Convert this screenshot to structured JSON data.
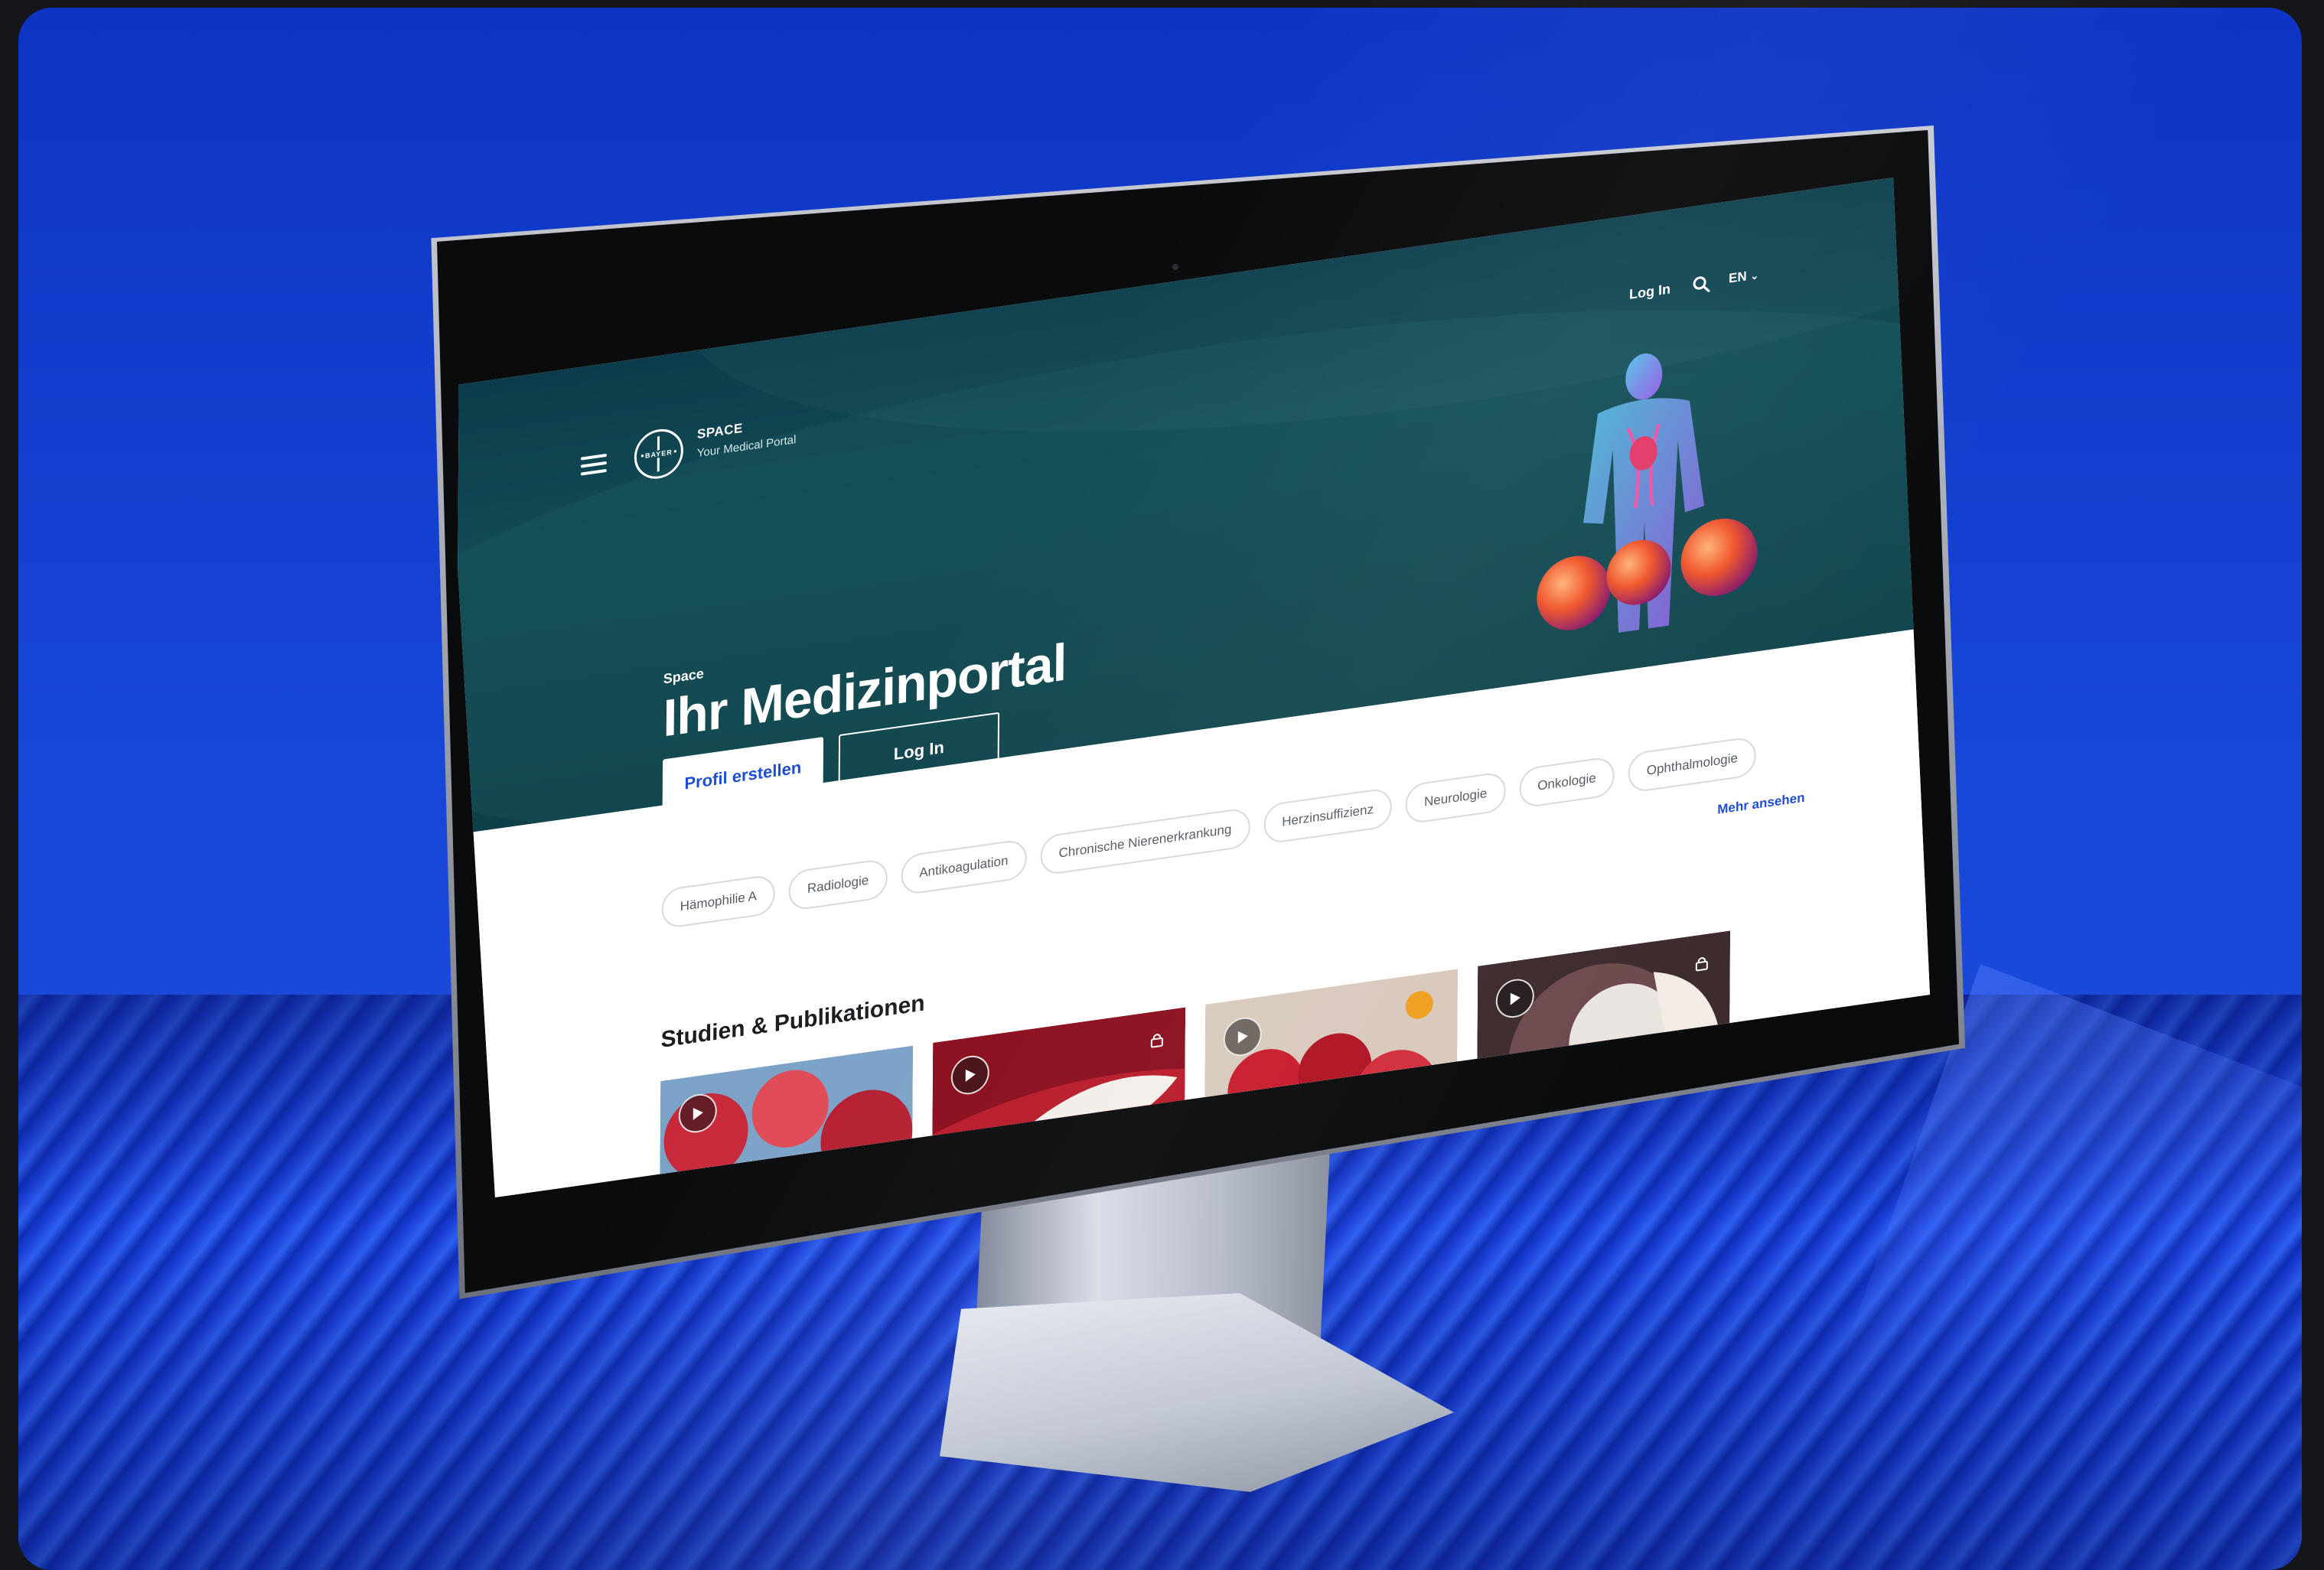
{
  "header": {
    "brand_name": "SPACE",
    "brand_tagline": "Your Medical Portal",
    "logo_text": "BAYER",
    "login_label": "Log In",
    "language_label": "EN"
  },
  "hero": {
    "eyebrow": "Space",
    "title": "Ihr Medizinportal",
    "primary_button": "Profil erstellen",
    "secondary_button": "Log In"
  },
  "topics": {
    "chips": [
      "Hämophilie A",
      "Radiologie",
      "Antikoagulation",
      "Chronische Nierenerkrankung",
      "Herzinsuffizienz",
      "Neurologie",
      "Onkologie",
      "Ophthalmologie"
    ],
    "more_label": "Mehr ansehen"
  },
  "publications": {
    "title": "Studien & Publikationen",
    "cards": [
      {
        "icon": "play-icon",
        "locked": false
      },
      {
        "icon": "play-icon",
        "locked": true
      },
      {
        "icon": "play-icon",
        "locked": false
      },
      {
        "icon": "play-icon",
        "locked": true
      }
    ]
  },
  "colors": {
    "background_blue": "#1745d6",
    "hero_teal": "#0f3f48",
    "accent_blue": "#1f4fd1",
    "chip_border": "#d6d9de"
  }
}
